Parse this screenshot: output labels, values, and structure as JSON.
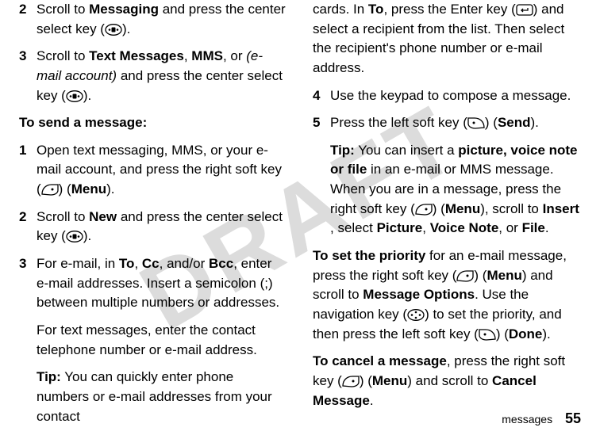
{
  "watermark": "DRAFT",
  "left": {
    "step2": {
      "num": "2",
      "t1": "Scroll to ",
      "b1": "Messaging",
      "t2": " and press the center select key (",
      "t3": ")."
    },
    "step3a": {
      "num": "3",
      "t1": "Scroll to ",
      "b1": "Text Messages",
      "t2": ", ",
      "b2": "MMS",
      "t3": ", or ",
      "i1": "(e-mail account)",
      "t4": " and press the center select key (",
      "t5": ")."
    },
    "heading": "To send a message:",
    "step1": {
      "num": "1",
      "t1": "Open text messaging, MMS, or your e-mail account, and press the right soft key (",
      "t2": ") (",
      "b1": "Menu",
      "t3": ")."
    },
    "step2b": {
      "num": "2",
      "t1": "Scroll to ",
      "b1": "New",
      "t2": " and press the center select key (",
      "t3": ")."
    },
    "step3b": {
      "num": "3",
      "t1": "For e-mail, in ",
      "b1": "To",
      "t2": ", ",
      "b2": "Cc",
      "t3": ", and/or ",
      "b3": "Bcc",
      "t4": ", enter e-mail addresses. Insert a semicolon (;) between multiple numbers or addresses."
    },
    "p1": "For text messages, enter the contact telephone number or e-mail address.",
    "tip": {
      "b1": "Tip:",
      "t1": " You can quickly enter phone numbers or e-mail addresses from your contact "
    }
  },
  "right": {
    "cont": {
      "t1": "cards. In ",
      "b1": "To",
      "t2": ", press the Enter key (",
      "t3": ") and select a recipient from the list. Then select the recipient's phone number or e-mail address."
    },
    "step4": {
      "num": "4",
      "t1": "Use the keypad to compose a message."
    },
    "step5": {
      "num": "5",
      "t1": "Press the left soft key (",
      "t2": ") (",
      "b1": "Send",
      "t3": ")."
    },
    "tip": {
      "b1": "Tip:",
      "t1": " You can insert a ",
      "b2": "picture, voice note or file",
      "t2": " in an e-mail or MMS message. When you are in a message, press the right soft key (",
      "t3": ") (",
      "b3": "Menu",
      "t4": "), scroll to ",
      "b4": "Insert",
      "t5": " , select ",
      "b5": "Picture",
      "t6": ", ",
      "b6": "Voice Note",
      "t7": ", or ",
      "b7": "File",
      "t8": "."
    },
    "prio": {
      "b1": "To set the priority",
      "t1": " for an e-mail message, press the right soft key (",
      "t2": ") (",
      "b2": "Menu",
      "t3": ") and scroll to  ",
      "b3": "Message Options",
      "t4": ". Use the navigation key (",
      "t5": ") to set the priority, and then press the left soft key (",
      "t6": ") (",
      "b4": "Done",
      "t7": ")."
    },
    "cancel": {
      "b1": "To cancel a message",
      "t1": ", press the right soft key (",
      "t2": ") (",
      "b2": "Menu",
      "t3": ") and scroll to ",
      "b3": "Cancel Message",
      "t4": "."
    }
  },
  "footer": {
    "section": "messages",
    "page": "55"
  }
}
